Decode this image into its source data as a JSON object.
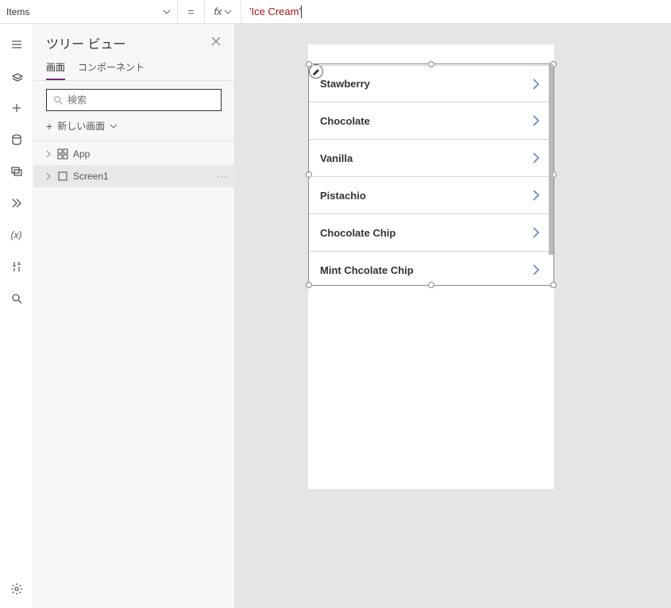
{
  "formula_bar": {
    "property": "Items",
    "eq": "=",
    "fx": "fx",
    "value": "'Ice Cream'"
  },
  "rail": {
    "icons": [
      "hamburger",
      "layers",
      "plus",
      "data",
      "media",
      "flows",
      "variables",
      "tools",
      "search"
    ],
    "gear": "settings"
  },
  "tree": {
    "title": "ツリー ビュー",
    "tabs": {
      "screens": "画面",
      "components": "コンポーネント"
    },
    "search_placeholder": "検索",
    "new_screen": "新しい画面",
    "nodes": {
      "app": "App",
      "screen1": "Screen1"
    },
    "more": "···"
  },
  "gallery": {
    "items": [
      {
        "title": "Stawberry"
      },
      {
        "title": "Chocolate"
      },
      {
        "title": "Vanilla"
      },
      {
        "title": "Pistachio"
      },
      {
        "title": "Chocolate Chip"
      },
      {
        "title": "Mint Chcolate Chip"
      }
    ]
  }
}
